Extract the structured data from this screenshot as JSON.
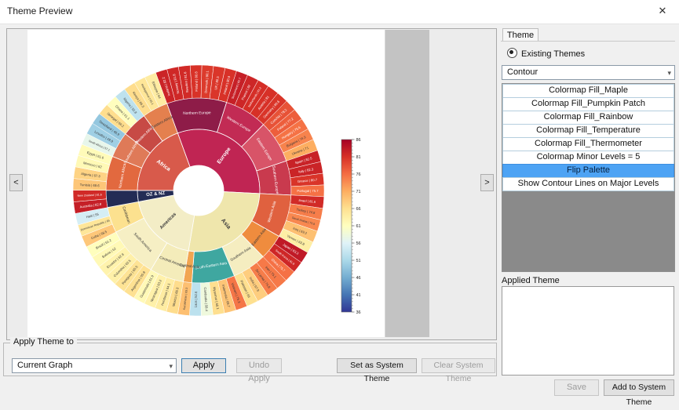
{
  "window": {
    "title": "Theme Preview"
  },
  "icons": {
    "close": "✕",
    "chevron_down": "▾",
    "prev": "<",
    "next": ">"
  },
  "right_panel": {
    "tab": "Theme",
    "radio_label": "Existing Themes",
    "dropdown_value": "Contour",
    "theme_items": [
      "Colormap Fill_Maple",
      "Colormap Fill_Pumpkin Patch",
      "Colormap Fill_Rainbow",
      "Colormap Fill_Temperature",
      "Colormap Fill_Thermometer",
      "Colormap Minor Levels = 5",
      "Flip Palette",
      "Show Contour Lines on Major Levels"
    ],
    "selected_item": "Flip Palette",
    "applied_theme_label": "Applied Theme",
    "save_label": "Save",
    "add_label": "Add to System Theme"
  },
  "apply_bar": {
    "group_label": "Apply Theme to",
    "target_value": "Current Graph",
    "apply_label": "Apply",
    "undo_label": "Undo Apply",
    "set_system_label": "Set as System Theme",
    "clear_system_label": "Clear System Theme"
  },
  "chart_data": {
    "type": "sunburst",
    "title": "",
    "colorbar": {
      "min": 36,
      "max": 86,
      "ticks": [
        86,
        81,
        76,
        71,
        66,
        61,
        56,
        51,
        46,
        41,
        36
      ],
      "stops": [
        [
          36,
          "#313695"
        ],
        [
          41,
          "#4575b4"
        ],
        [
          46,
          "#74add1"
        ],
        [
          51,
          "#abd9e9"
        ],
        [
          56,
          "#e0f3f8"
        ],
        [
          61,
          "#ffffbf"
        ],
        [
          66,
          "#fee090"
        ],
        [
          71,
          "#fdae61"
        ],
        [
          76,
          "#f46d43"
        ],
        [
          81,
          "#d73027"
        ],
        [
          86,
          "#a50026"
        ]
      ]
    },
    "start_angle": -20,
    "continents": [
      {
        "name": "Europe",
        "color": "#c02553",
        "regions": [
          {
            "name": "Northern Europe",
            "color": "#8e1c48",
            "countries": [
              [
                "Iceland",
                82.2
              ],
              [
                "Norway",
                81.8
              ],
              [
                "Sweden",
                81.6
              ],
              [
                "Finland",
                80.8
              ],
              [
                "Denmark",
                80.1
              ],
              [
                "UK",
                80.5
              ],
              [
                "Ireland",
                80.9
              ]
            ]
          },
          {
            "name": "Western Europe",
            "color": "#c22b54",
            "countries": [
              [
                "Switzerland",
                82.7
              ],
              [
                "France",
                82.0
              ],
              [
                "Netherlands",
                81.2
              ],
              [
                "Austria",
                81.0
              ],
              [
                "Germany",
                80.6
              ]
            ]
          },
          {
            "name": "Eastern Europe",
            "color": "#d85468",
            "countries": [
              [
                "Czechia",
                78.2
              ],
              [
                "Poland",
                77.2
              ],
              [
                "Hungary",
                75.6
              ],
              [
                "Bulgaria",
                74.3
              ],
              [
                "Ukraine",
                71.0
              ]
            ]
          },
          {
            "name": "Southern Europe",
            "color": "#c93a4e",
            "countries": [
              [
                "Spain",
                82.5
              ],
              [
                "Italy",
                82.3
              ],
              [
                "Greece",
                80.7
              ],
              [
                "Portugal",
                75.7
              ]
            ]
          }
        ]
      },
      {
        "name": "Asia",
        "color": "#efe6ac",
        "regions": [
          {
            "name": "Western Asia",
            "color": "#e0613f",
            "countries": [
              [
                "Israel",
                81.6
              ],
              [
                "Turkey",
                74.8
              ],
              [
                "Saudi Arabia",
                73.9
              ],
              [
                "Iraq",
                69.2
              ],
              [
                "Yemen",
                63.8
              ]
            ]
          },
          {
            "name": "Eastern Asia",
            "color": "#ef8c3e",
            "countries": [
              [
                "Japan",
                83.3
              ],
              [
                "South Korea",
                81.9
              ],
              [
                "China",
                75.7
              ]
            ]
          },
          {
            "name": "Southern Asia",
            "color": "#f5edc0",
            "countries": [
              [
                "Iran",
                75.1
              ],
              [
                "Sri Lanka",
                74.8
              ],
              [
                "India",
                67.9
              ],
              [
                "Pakistan",
                66.0
              ]
            ]
          },
          {
            "name": "South-Eastern Asia",
            "color": "#3fa7a0",
            "countries": [
              [
                "Vietnam",
                75.3
              ],
              [
                "Indonesia",
                68.7
              ],
              [
                "Myanmar",
                66.1
              ],
              [
                "Cambodia",
                58.4
              ],
              [
                "Laos",
                52.6
              ]
            ]
          },
          {
            "name": "Central Asia",
            "color": "#f2a551",
            "countries": [
              [
                "Kazakhstan",
                69.3
              ]
            ]
          }
        ]
      },
      {
        "name": "Americas",
        "color": "#f3edc6",
        "regions": [
          {
            "name": "Central America",
            "color": "#f4ecba",
            "countries": [
              [
                "Mexico",
                66.3
              ],
              [
                "Honduras",
                64.1
              ],
              [
                "Nicaragua",
                63.2
              ],
              [
                "Guatemala",
                61.9
              ]
            ]
          },
          {
            "name": "South America",
            "color": "#f6efc4",
            "countries": [
              [
                "Argentina",
                65.8
              ],
              [
                "Paraguay",
                65.5
              ],
              [
                "Colombia",
                63.5
              ],
              [
                "Ecuador",
                62.9
              ],
              [
                "Bolivia",
                62.0
              ],
              [
                "Brazil",
                61.2
              ]
            ]
          },
          {
            "name": "Caribbean",
            "color": "#fce18f",
            "countries": [
              [
                "Cuba",
                68.5
              ],
              [
                "Dominican Republic",
                65.0
              ],
              [
                "Haiti",
                55.0
              ]
            ]
          }
        ]
      },
      {
        "name": "OZ & NZ",
        "color": "#232c55",
        "regions": [
          {
            "name": "",
            "color": "#232c55",
            "countries": [
              [
                "Australia",
                82.8
              ],
              [
                "New Zealand",
                81.6
              ]
            ]
          }
        ]
      },
      {
        "name": "Africa",
        "color": "#d85a4b",
        "regions": [
          {
            "name": "Northern Africa",
            "color": "#e2693f",
            "countries": [
              [
                "Tunisia",
                68.6
              ],
              [
                "Algeria",
                67.3
              ],
              [
                "Morocco",
                62.0
              ],
              [
                "Egypt",
                61.6
              ]
            ]
          },
          {
            "name": "Southern Africa",
            "color": "#df7a58",
            "countries": [
              [
                "South Africa",
                57.1
              ],
              [
                "Lesotho",
                49.9
              ],
              [
                "Swaziland",
                48.9
              ]
            ]
          },
          {
            "name": "Western Africa",
            "color": "#c74a45",
            "countries": [
              [
                "Senegal",
                66.2
              ],
              [
                "Ghana",
                61.1
              ],
              [
                "Nigeria",
                52.8
              ]
            ]
          },
          {
            "name": "Eastern Africa",
            "color": "#e4804e",
            "countries": [
              [
                "Kenya",
                66.3
              ],
              [
                "Madagascar",
                65.1
              ],
              [
                "Ethiopia",
                64.0
              ]
            ]
          }
        ]
      }
    ]
  }
}
